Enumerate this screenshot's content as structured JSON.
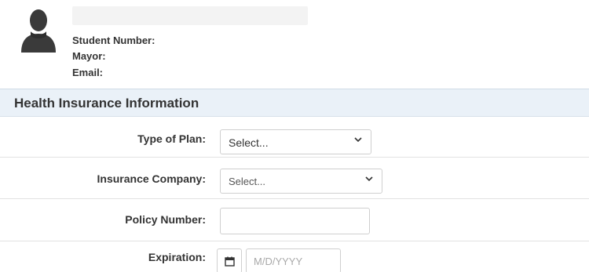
{
  "profile": {
    "avatar_icon": "user-silhouette-icon",
    "fields": {
      "student_number_label": "Student Number:",
      "mayor_label": "Mayor:",
      "email_label": "Email:"
    }
  },
  "section": {
    "title": "Health Insurance Information"
  },
  "form": {
    "type_of_plan": {
      "label": "Type of Plan:",
      "selected": "Select..."
    },
    "insurance_company": {
      "label": "Insurance Company:",
      "selected": "Select..."
    },
    "policy_number": {
      "label": "Policy Number:",
      "value": ""
    },
    "expiration": {
      "label": "Expiration:",
      "placeholder": "M/D/YYYY",
      "icon": "calendar-icon"
    }
  },
  "colors": {
    "section_bg": "#eaf1f8",
    "border": "#cfcfcf",
    "text": "#333333",
    "avatar": "#3a3a3a"
  }
}
